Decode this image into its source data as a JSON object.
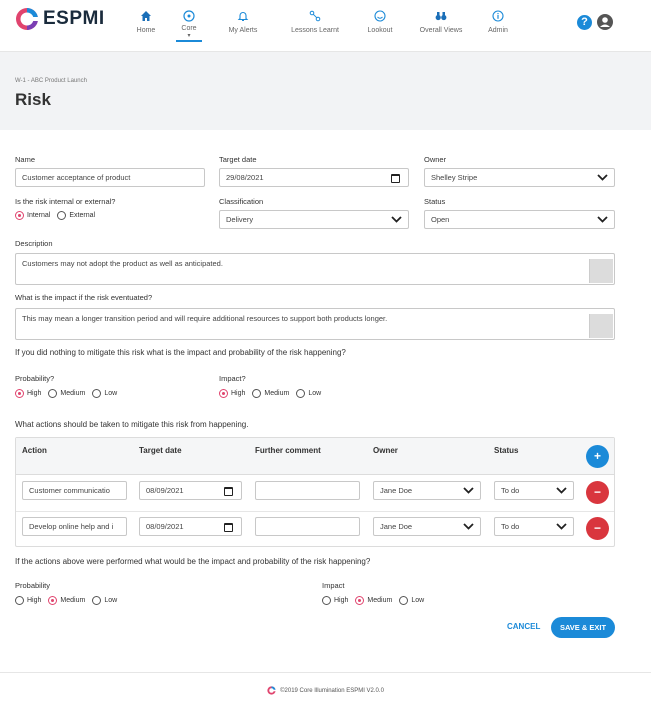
{
  "app": {
    "logo_text": "ESPMI"
  },
  "nav": [
    {
      "label": "Home",
      "icon": "home-icon"
    },
    {
      "label": "Core",
      "icon": "compass-icon",
      "active": true
    },
    {
      "label": "My Alerts",
      "icon": "bell-icon"
    },
    {
      "label": "Lessons Learnt",
      "icon": "nodes-icon"
    },
    {
      "label": "Lookout",
      "icon": "target-icon"
    },
    {
      "label": "Overall Views",
      "icon": "binoculars-icon"
    },
    {
      "label": "Admin",
      "icon": "info-icon"
    }
  ],
  "header": {
    "help": "?",
    "breadcrumb": "W-1 - ABC Product Launch",
    "title": "Risk"
  },
  "form": {
    "name": {
      "label": "Name",
      "value": "Customer acceptance of product"
    },
    "target_date": {
      "label": "Target date",
      "value": "29/08/2021"
    },
    "owner": {
      "label": "Owner",
      "value": "Shelley Stripe"
    },
    "internal_external": {
      "label": "Is the risk internal or external?",
      "options": [
        "Internal",
        "External"
      ],
      "selected": "Internal"
    },
    "classification": {
      "label": "Classification",
      "value": "Delivery"
    },
    "status": {
      "label": "Status",
      "value": "Open"
    },
    "description": {
      "label": "Description",
      "value": "Customers may not adopt the product as well as anticipated."
    },
    "impact_text": {
      "label": "What is the impact if the risk eventuated?",
      "value": "This may mean a longer transition period and will require additional resources to support both products longer."
    },
    "do_nothing_question": "If you did nothing to mitigate this risk what is the impact and probability of the risk happening?",
    "probability": {
      "label": "Probability?",
      "options": [
        "High",
        "Medium",
        "Low"
      ],
      "selected": "High"
    },
    "impact": {
      "label": "Impact?",
      "options": [
        "High",
        "Medium",
        "Low"
      ],
      "selected": "High"
    },
    "actions_question": "What actions should be taken to mitigate this risk from happening.",
    "actions_table": {
      "headers": [
        "Action",
        "Target date",
        "Further comment",
        "Owner",
        "Status"
      ],
      "rows": [
        {
          "action": "Customer communicatio",
          "target_date": "08/09/2021",
          "comment": "",
          "owner": "Jane Doe",
          "status": "To do"
        },
        {
          "action": "Develop online help and i",
          "target_date": "08/09/2021",
          "comment": "",
          "owner": "Jane Doe",
          "status": "To do"
        }
      ],
      "add_label": "+",
      "remove_label": "−"
    },
    "after_question": "If the actions above were performed what would be the impact and probability of the risk happening?",
    "probability_after": {
      "label": "Probability",
      "options": [
        "High",
        "Medium",
        "Low"
      ],
      "selected": "Medium"
    },
    "impact_after": {
      "label": "Impact",
      "options": [
        "High",
        "Medium",
        "Low"
      ],
      "selected": "Medium"
    }
  },
  "buttons": {
    "cancel": "CANCEL",
    "save": "SAVE & EXIT"
  },
  "footer": {
    "text": "©2019 Core Illumination ESPMI V2.0.0"
  },
  "colors": {
    "accent": "#1b8ad8",
    "radio_selected": "#e0446e",
    "danger": "#d9363e"
  }
}
